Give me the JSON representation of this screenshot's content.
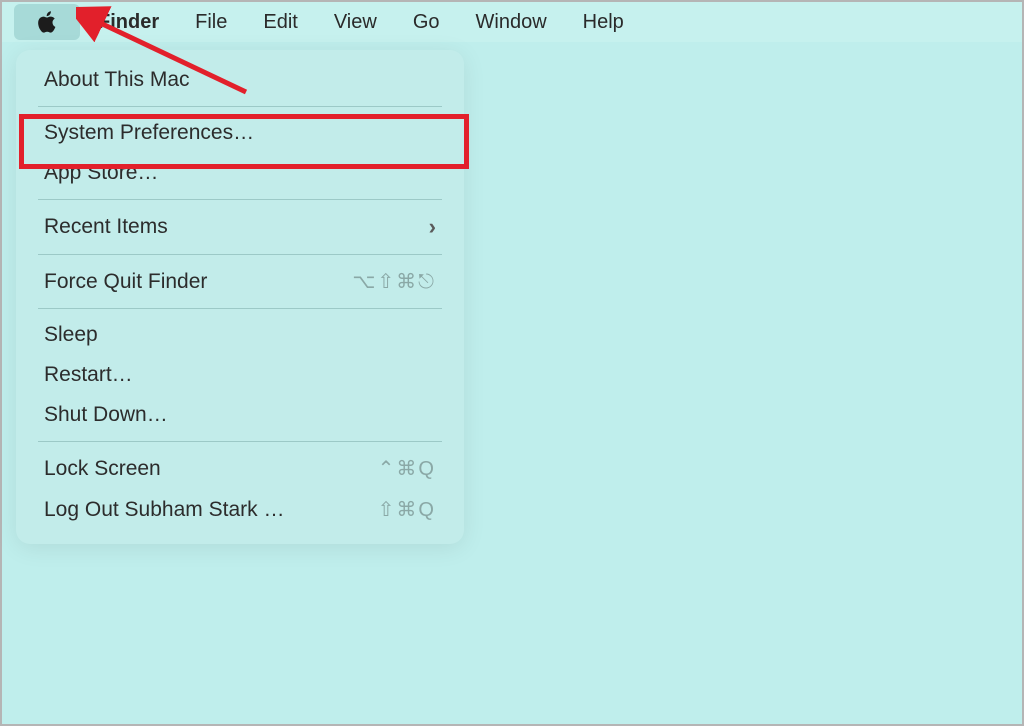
{
  "menubar": {
    "apple_icon": "apple",
    "items": [
      "Finder",
      "File",
      "Edit",
      "View",
      "Go",
      "Window",
      "Help"
    ]
  },
  "dropdown": {
    "about": "About This Mac",
    "system_preferences": "System Preferences…",
    "app_store": "App Store…",
    "recent_items": "Recent Items",
    "force_quit": "Force Quit Finder",
    "force_quit_shortcut": "⌥⇧⌘⎋",
    "sleep": "Sleep",
    "restart": "Restart…",
    "shutdown": "Shut Down…",
    "lock_screen": "Lock Screen",
    "lock_screen_shortcut": "⌃⌘Q",
    "logout": "Log Out Subham  Stark …",
    "logout_shortcut": "⇧⌘Q"
  },
  "annotations": {
    "highlight_target": "system-preferences",
    "arrow_target": "apple-menu"
  }
}
